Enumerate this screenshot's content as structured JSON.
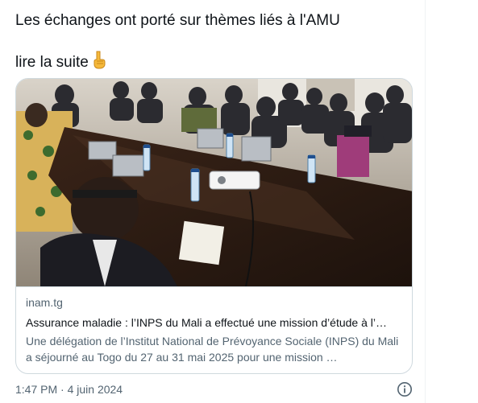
{
  "tweet": {
    "text": "Les échanges ont porté sur thèmes liés à l'AMU",
    "read_more": "lire la suite",
    "pointing_emoji": "👇"
  },
  "card": {
    "image_icon": "conference-room-photo",
    "domain": "inam.tg",
    "title": "Assurance maladie : l’INPS du Mali a effectué une mission d’étude à l’…",
    "description": "Une délégation de l’Institut National de Prévoyance Sociale (INPS) du Mali a séjourné au Togo du 27 au 31 mai 2025 pour une mission …"
  },
  "meta": {
    "timestamp": "1:47 PM · 4 juin 2024",
    "info_icon": "info-icon"
  },
  "colors": {
    "text_primary": "#0f1419",
    "text_secondary": "#536471",
    "border": "#cfd9de"
  }
}
